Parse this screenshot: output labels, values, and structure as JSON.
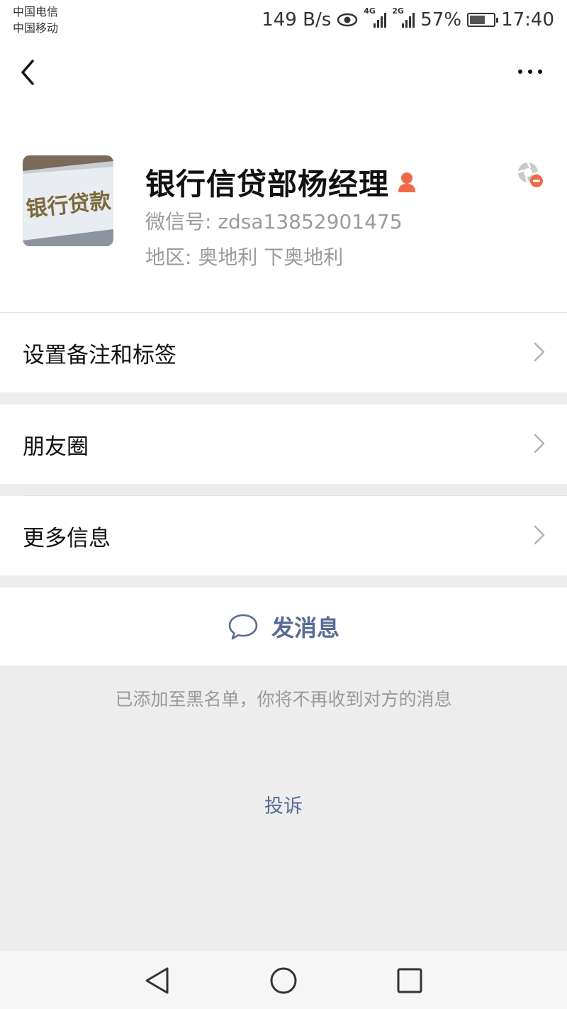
{
  "status_bar": {
    "carrier_1": "中国电信",
    "carrier_2": "中国移动",
    "net_speed": "149 B/s",
    "net_1": "4G",
    "net_2": "2G",
    "battery": "57%",
    "time": "17:40"
  },
  "profile": {
    "nickname": "银行信贷部杨经理",
    "wechat_id": "微信号:  zdsa13852901475",
    "region": "地区:  奥地利   下奥地利",
    "avatar_text": "银行贷款"
  },
  "menu": {
    "remark_tags": "设置备注和标签",
    "moments": "朋友圈",
    "more_info": "更多信息"
  },
  "actions": {
    "send_message": "发消息",
    "blacklist_note": "已添加至黑名单，你将不再收到对方的消息",
    "complain": "投诉"
  },
  "colors": {
    "link": "#576b95",
    "gender_female": "#f0684a"
  }
}
